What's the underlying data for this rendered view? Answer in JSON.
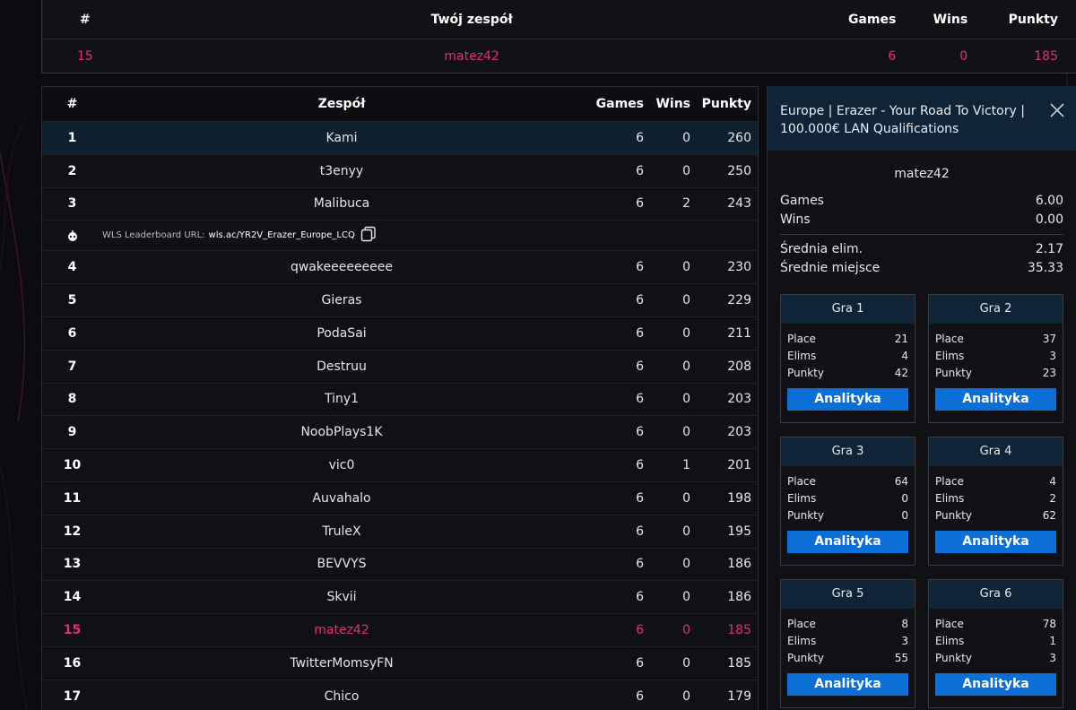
{
  "my_team": {
    "headers": {
      "rank": "#",
      "team": "Twój zespół",
      "games": "Games",
      "wins": "Wins",
      "points": "Punkty"
    },
    "row": {
      "rank": "15",
      "team": "matez42",
      "games": "6",
      "wins": "0",
      "points": "185"
    }
  },
  "leaderboard": {
    "headers": {
      "rank": "#",
      "team": "Zespół",
      "games": "Games",
      "wins": "Wins",
      "points": "Punkty"
    },
    "rows_top": [
      {
        "rank": "1",
        "team": "Kami",
        "games": "6",
        "wins": "0",
        "points": "260"
      },
      {
        "rank": "2",
        "team": "t3enyy",
        "games": "6",
        "wins": "0",
        "points": "250"
      },
      {
        "rank": "3",
        "team": "Malibuca",
        "games": "6",
        "wins": "2",
        "points": "243"
      }
    ],
    "url_label": "WLS Leaderboard URL:",
    "url_value": "wls.ac/YR2V_Erazer_Europe_LCQ",
    "rows": [
      {
        "rank": "4",
        "team": "qwakeeeeeeeee",
        "games": "6",
        "wins": "0",
        "points": "230"
      },
      {
        "rank": "5",
        "team": "Gieras",
        "games": "6",
        "wins": "0",
        "points": "229"
      },
      {
        "rank": "6",
        "team": "PodaSai",
        "games": "6",
        "wins": "0",
        "points": "211"
      },
      {
        "rank": "7",
        "team": "Destruu",
        "games": "6",
        "wins": "0",
        "points": "208"
      },
      {
        "rank": "8",
        "team": "Tiny1",
        "games": "6",
        "wins": "0",
        "points": "203"
      },
      {
        "rank": "9",
        "team": "NoobPlays1K",
        "games": "6",
        "wins": "0",
        "points": "203"
      },
      {
        "rank": "10",
        "team": "vic0",
        "games": "6",
        "wins": "1",
        "points": "201"
      },
      {
        "rank": "11",
        "team": "Auvahalo",
        "games": "6",
        "wins": "0",
        "points": "198"
      },
      {
        "rank": "12",
        "team": "TruleX",
        "games": "6",
        "wins": "0",
        "points": "195"
      },
      {
        "rank": "13",
        "team": "BEVVYS",
        "games": "6",
        "wins": "0",
        "points": "186"
      },
      {
        "rank": "14",
        "team": "Skvii",
        "games": "6",
        "wins": "0",
        "points": "186"
      },
      {
        "rank": "15",
        "team": "matez42",
        "games": "6",
        "wins": "0",
        "points": "185",
        "highlight": true
      },
      {
        "rank": "16",
        "team": "TwitterMomsyFN",
        "games": "6",
        "wins": "0",
        "points": "185"
      },
      {
        "rank": "17",
        "team": "Chico",
        "games": "6",
        "wins": "0",
        "points": "179"
      }
    ]
  },
  "panel": {
    "title": "Europe | Erazer - Your Road To Victory | 100.000€ LAN Qualifications",
    "team_name": "matez42",
    "stats": [
      {
        "label": "Games",
        "value": "6.00"
      },
      {
        "label": "Wins",
        "value": "0.00"
      }
    ],
    "stats2": [
      {
        "label": "Średnia elim.",
        "value": "2.17"
      },
      {
        "label": "Średnie miejsce",
        "value": "35.33"
      }
    ],
    "stat_labels": {
      "place": "Place",
      "elims": "Elims",
      "points": "Punkty"
    },
    "button_label": "Analityka",
    "games": [
      {
        "title": "Gra 1",
        "place": "21",
        "elims": "4",
        "points": "42"
      },
      {
        "title": "Gra 2",
        "place": "37",
        "elims": "3",
        "points": "23"
      },
      {
        "title": "Gra 3",
        "place": "64",
        "elims": "0",
        "points": "0"
      },
      {
        "title": "Gra 4",
        "place": "4",
        "elims": "2",
        "points": "62"
      },
      {
        "title": "Gra 5",
        "place": "8",
        "elims": "3",
        "points": "55"
      },
      {
        "title": "Gra 6",
        "place": "78",
        "elims": "1",
        "points": "3"
      }
    ]
  },
  "colors": {
    "accent_pink": "#e0336a",
    "button_blue": "#0c6fd6",
    "panel_header": "#0f2436"
  }
}
